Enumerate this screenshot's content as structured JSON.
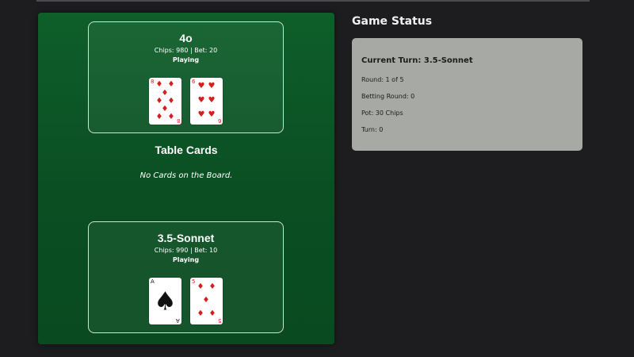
{
  "players": [
    {
      "name": "4o",
      "info": "Chips: 980 | Bet: 20",
      "status": "Playing",
      "cards": [
        {
          "rank": "8",
          "suit": "diamonds",
          "symbol": "♦",
          "color": "red"
        },
        {
          "rank": "6",
          "suit": "hearts",
          "symbol": "♥",
          "color": "red"
        }
      ]
    },
    {
      "name": "3.5-Sonnet",
      "info": "Chips: 990 | Bet: 10",
      "status": "Playing",
      "cards": [
        {
          "rank": "A",
          "suit": "spades",
          "symbol": "♠",
          "color": "black"
        },
        {
          "rank": "5",
          "suit": "diamonds",
          "symbol": "♦",
          "color": "red"
        }
      ]
    }
  ],
  "table": {
    "title": "Table Cards",
    "empty_message": "No Cards on the Board."
  },
  "status": {
    "heading": "Game Status",
    "current_turn": "Current Turn: 3.5-Sonnet",
    "round": "Round: 1 of 5",
    "betting_round": "Betting Round: 0",
    "pot": "Pot: 30 Chips",
    "turn": "Turn: 0"
  },
  "colors": {
    "felt": "#0d5a28",
    "red_suit": "#d21f1f",
    "status_panel": "#a7a9a5"
  }
}
